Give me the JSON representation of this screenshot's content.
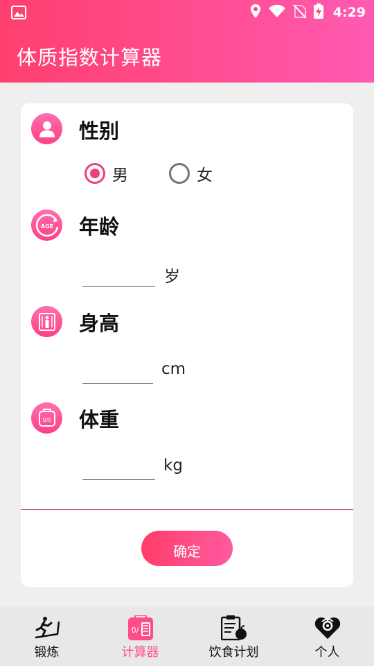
{
  "status_bar": {
    "time": "4:29"
  },
  "app": {
    "title": "体质指数计算器"
  },
  "sections": {
    "gender": {
      "title": "性别",
      "options": [
        {
          "label": "男",
          "selected": true
        },
        {
          "label": "女",
          "selected": false
        }
      ]
    },
    "age": {
      "title": "年龄",
      "icon_text": "AGE",
      "value": "",
      "unit": "岁"
    },
    "height": {
      "title": "身高",
      "value": "",
      "unit": "cm"
    },
    "weight": {
      "title": "体重",
      "value": "",
      "unit": "kg"
    }
  },
  "confirm_label": "确定",
  "nav": [
    {
      "label": "锻炼",
      "icon": "treadmill-icon",
      "active": false
    },
    {
      "label": "计算器",
      "icon": "calculator-icon",
      "active": true
    },
    {
      "label": "饮食计划",
      "icon": "meal-plan-icon",
      "active": false
    },
    {
      "label": "个人",
      "icon": "profile-heart-icon",
      "active": false
    }
  ],
  "colors": {
    "accent": "#ff4d8a",
    "header_start": "#ff3f6e",
    "header_end": "#ff5ab2",
    "radio_checked": "#f03f7a"
  }
}
